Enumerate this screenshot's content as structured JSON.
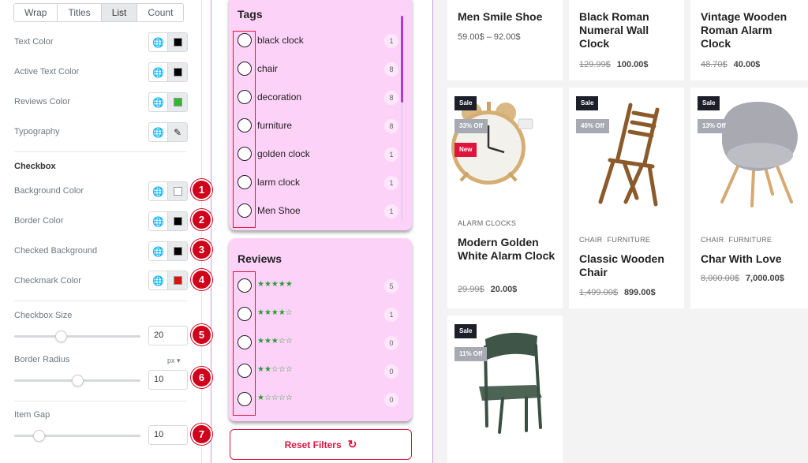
{
  "editor": {
    "tabs": [
      {
        "label": "Wrap",
        "active": false
      },
      {
        "label": "Titles",
        "active": false
      },
      {
        "label": "List",
        "active": true
      },
      {
        "label": "Count",
        "active": false
      }
    ],
    "colors_section": {
      "text_color": {
        "label": "Text Color",
        "value": "#000000"
      },
      "active_text_color": {
        "label": "Active Text Color",
        "value": "#000000"
      },
      "reviews_color": {
        "label": "Reviews Color",
        "value": "#2db82d"
      },
      "typography": {
        "label": "Typography"
      }
    },
    "checkbox_section": {
      "title": "Checkbox",
      "background_color": {
        "label": "Background Color",
        "value": "#ffffff",
        "marker": "1"
      },
      "border_color": {
        "label": "Border Color",
        "value": "#000000",
        "marker": "2"
      },
      "checked_background": {
        "label": "Checked Background",
        "value": "#000000",
        "marker": "3"
      },
      "checkmark_color": {
        "label": "Checkmark Color",
        "value": "#e01010",
        "marker": "4"
      }
    },
    "checkbox_size": {
      "label": "Checkbox Size",
      "value": "20",
      "marker": "5",
      "slider_fraction": 0.37
    },
    "border_radius": {
      "label": "Border Radius",
      "unit": "px",
      "value": "10",
      "marker": "6",
      "slider_fraction": 0.5
    },
    "item_gap": {
      "label": "Item Gap",
      "value": "10",
      "marker": "7",
      "slider_fraction": 0.2
    }
  },
  "tags_widget": {
    "title": "Tags",
    "items": [
      {
        "label": "black clock",
        "count": "1"
      },
      {
        "label": "chair",
        "count": "8"
      },
      {
        "label": "decoration",
        "count": "8"
      },
      {
        "label": "furniture",
        "count": "8"
      },
      {
        "label": "golden clock",
        "count": "1"
      },
      {
        "label": "larm clock",
        "count": "1"
      },
      {
        "label": "Men Shoe",
        "count": "1"
      }
    ]
  },
  "reviews_widget": {
    "title": "Reviews",
    "items": [
      {
        "stars": "★★★★★",
        "rating": 5,
        "count": "5"
      },
      {
        "stars": "★★★★☆",
        "rating": 4,
        "count": "1"
      },
      {
        "stars": "★★★☆☆",
        "rating": 3,
        "count": "0"
      },
      {
        "stars": "★★☆☆☆",
        "rating": 2,
        "count": "0"
      },
      {
        "stars": "★☆☆☆☆",
        "rating": 1,
        "count": "0"
      }
    ]
  },
  "reset_button": {
    "label": "Reset Filters",
    "icon": "refresh-icon"
  },
  "products": [
    {
      "name": "Men Smile Shoe",
      "price_range": "59.00$ – 92.00$"
    },
    {
      "name": "Black Roman Numeral Wall Clock",
      "old_price": "129.99$",
      "price": "100.00$"
    },
    {
      "name": "Vintage Wooden Roman Alarm Clock",
      "old_price": "48.70$",
      "price": "40.00$"
    },
    {
      "name": "Modern Golden White Alarm Clock",
      "categories": [
        "ALARM CLOCKS"
      ],
      "old_price": "29.99$",
      "price": "20.00$",
      "badges": [
        "Sale",
        "33% Off",
        "New"
      ]
    },
    {
      "name": "Classic Wooden Chair",
      "categories": [
        "CHAIR",
        "FURNITURE"
      ],
      "old_price": "1,499.00$",
      "price": "899.00$",
      "badges": [
        "Sale",
        "40% Off"
      ]
    },
    {
      "name": "Char With Love",
      "categories": [
        "CHAIR",
        "FURNITURE"
      ],
      "old_price": "8,000.00$",
      "price": "7,000.00$",
      "badges": [
        "Sale",
        "13% Off"
      ]
    },
    {
      "badges": [
        "Sale",
        "11% Off"
      ]
    }
  ],
  "colors": {
    "accent_red": "#e0143c",
    "widget_pink": "#fdd2f8",
    "divider_purple": "#c79ae0",
    "star_green": "#2d9b38"
  }
}
